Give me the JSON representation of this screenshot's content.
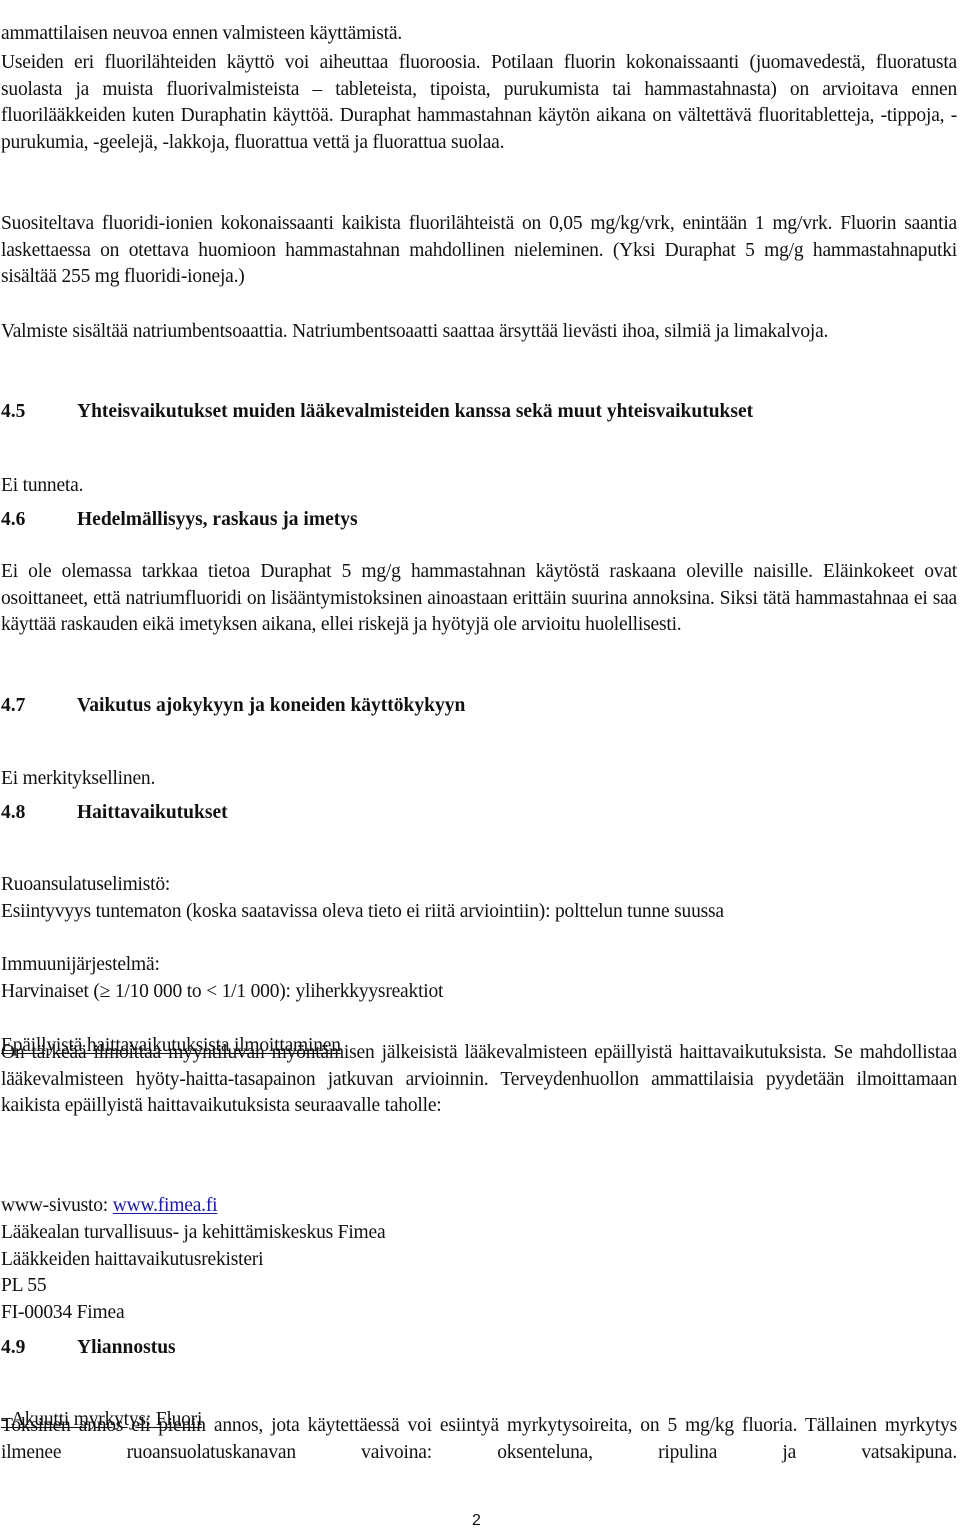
{
  "document": {
    "para_intro_tail": "ammattilaisen neuvoa ennen valmisteen käyttämistä.",
    "para_fluorosis": "Useiden eri fluorilähteiden käyttö voi aiheuttaa fluoroosia. Potilaan fluorin kokonaissaanti (juomavedestä, fluoratusta suolasta ja muista fluorivalmisteista – tableteista, tipoista, purukumista tai hammastahnasta) on arvioitava ennen fluorilääkkeiden kuten Duraphatin käyttöä. Duraphat hammastahnan käytön aikana on vältettävä fluoritabletteja, -tippoja, -purukumia, -geelejä, -lakkoja, fluorattua vettä ja fluorattua suolaa.",
    "para_intake": "Suositeltava fluoridi-ionien kokonaissaanti kaikista fluorilähteistä on 0,05 mg/kg/vrk, enintään 1 mg/vrk. Fluorin saantia laskettaessa on otettava huomioon hammastahnan mahdollinen nieleminen. (Yksi Duraphat 5 mg/g hammastahnaputki sisältää 255 mg fluoridi-ioneja.)",
    "para_benzoate": "Valmiste sisältää natriumbentsoaattia. Natriumbentsoaatti saattaa ärsyttää lievästi ihoa, silmiä ja limakalvoja.",
    "sections": [
      {
        "number": "4.5",
        "title": "Yhteisvaikutukset muiden lääkevalmisteiden kanssa sekä muut yhteisvaikutukset",
        "body": "Ei tunneta."
      },
      {
        "number": "4.6",
        "title": "Hedelmällisyys, raskaus ja imetys",
        "body": "Ei ole olemassa tarkkaa tietoa Duraphat 5 mg/g hammastahnan käytöstä raskaana oleville naisille. Eläinkokeet ovat osoittaneet, että natriumfluoridi on lisääntymistoksinen ainoastaan erittäin suurina annoksina. Siksi tätä hammastahnaa ei saa käyttää raskauden eikä imetyksen aikana, ellei riskejä ja hyötyjä ole arvioitu huolellisesti."
      },
      {
        "number": "4.7",
        "title": "Vaikutus ajokykyyn ja koneiden käyttökykyyn",
        "body": "Ei merkityksellinen."
      },
      {
        "number": "4.8",
        "title": "Haittavaikutukset",
        "gi_label": "Ruoansulatuselimistö:",
        "gi_text": "Esiintyvyys tuntematon (koska saatavissa oleva tieto ei riitä arviointiin): polttelun tunne suussa",
        "immune_label": "Immuunijärjestelmä:",
        "immune_text": "Harvinaiset (≥ 1/10 000 to < 1/1 000): yliherkkyysreaktiot",
        "report_heading": "Epäillyistä haittavaikutuksista ilmoittaminen",
        "report_text": "On tärkeää ilmoittaa myyntiluvan myöntämisen jälkeisistä lääkevalmisteen epäillyistä haittavaikutuksista. Se mahdollistaa lääkevalmisteen hyöty-haitta-tasapainon jatkuvan arvioinnin. Terveydenhuollon ammattilaisia pyydetään ilmoittamaan kaikista epäillyistä haittavaikutuksista seuraavalle taholle:",
        "website_label": "www-sivusto: ",
        "website_link": "www.fimea.fi",
        "address": [
          "Lääkealan turvallisuus- ja kehittämiskeskus Fimea",
          "Lääkkeiden haittavaikutusrekisteri",
          "PL 55",
          "FI-00034 Fimea"
        ]
      },
      {
        "number": "4.9",
        "title": "Yliannostus",
        "sub_heading": "- Akuutti myrkytys: Fluori",
        "body": "Toksinen annos eli pienin annos, jota käytettäessä voi esiintyä myrkytysoireita, on 5 mg/kg fluoria. Tällainen myrkytys ilmenee ruoansuolatuskanavan vaivoina: oksenteluna, ripulina ja vatsakipuna."
      }
    ],
    "page_number": "2"
  }
}
